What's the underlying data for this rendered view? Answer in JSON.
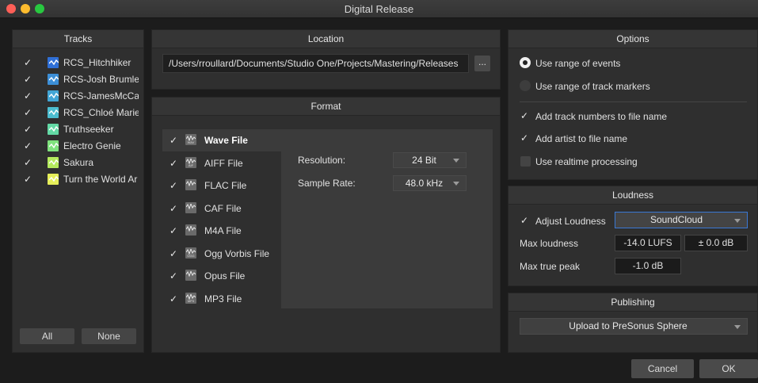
{
  "window": {
    "title": "Digital Release",
    "lights": [
      "#fe5f57",
      "#febc2e",
      "#28c840"
    ]
  },
  "tracks": {
    "header": "Tracks",
    "items": [
      {
        "label": "RCS_Hitchhiker",
        "color": "#2f6fd6",
        "checked": true
      },
      {
        "label": "RCS-Josh Brumle",
        "color": "#3c8ed6",
        "checked": true
      },
      {
        "label": "RCS-JamesMcCa",
        "color": "#42a6d6",
        "checked": true
      },
      {
        "label": "RCS_Chloé Marie",
        "color": "#4cbdd0",
        "checked": true
      },
      {
        "label": "Truthseeker",
        "color": "#63d9a5",
        "checked": true
      },
      {
        "label": "Electro Genie",
        "color": "#7fe27d",
        "checked": true
      },
      {
        "label": "Sakura",
        "color": "#b4ea5e",
        "checked": true
      },
      {
        "label": "Turn the World Ar",
        "color": "#e6ef5a",
        "checked": true
      }
    ],
    "all_label": "All",
    "none_label": "None"
  },
  "location": {
    "header": "Location",
    "path": "/Users/rroullard/Documents/Studio One/Projects/Mastering/Releases",
    "browse_label": "..."
  },
  "format": {
    "header": "Format",
    "items": [
      {
        "label": "Wave File",
        "tag": "WAV",
        "checked": true,
        "selected": true
      },
      {
        "label": "AIFF File",
        "tag": "AIF",
        "checked": true
      },
      {
        "label": "FLAC File",
        "tag": "",
        "checked": true
      },
      {
        "label": "CAF File",
        "tag": "",
        "checked": true
      },
      {
        "label": "M4A File",
        "tag": "",
        "checked": true
      },
      {
        "label": "Ogg Vorbis File",
        "tag": "OGG",
        "checked": true
      },
      {
        "label": "Opus File",
        "tag": "",
        "checked": true
      },
      {
        "label": "MP3 File",
        "tag": "MP3",
        "checked": true
      }
    ],
    "resolution_label": "Resolution:",
    "resolution_value": "24 Bit",
    "sample_rate_label": "Sample Rate:",
    "sample_rate_value": "48.0 kHz"
  },
  "options": {
    "header": "Options",
    "range_events": "Use range of events",
    "range_events_selected": true,
    "range_markers": "Use range of track markers",
    "track_numbers": "Add track numbers to file name",
    "track_numbers_checked": true,
    "artist": "Add artist to file name",
    "artist_checked": true,
    "realtime": "Use realtime processing",
    "realtime_checked": false
  },
  "loudness": {
    "header": "Loudness",
    "adjust_label": "Adjust Loudness",
    "adjust_checked": true,
    "preset": "SoundCloud",
    "max_loudness_label": "Max loudness",
    "max_loudness_value": "-14.0 LUFS",
    "tolerance_value": "± 0.0 dB",
    "true_peak_label": "Max true peak",
    "true_peak_value": "-1.0 dB"
  },
  "publishing": {
    "header": "Publishing",
    "destination": "Upload to PreSonus Sphere"
  },
  "footer": {
    "cancel_label": "Cancel",
    "ok_label": "OK"
  }
}
